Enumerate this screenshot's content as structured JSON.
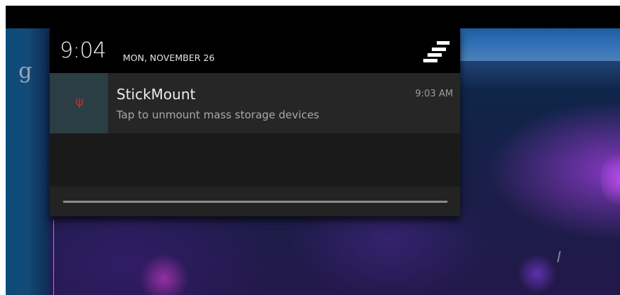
{
  "status_bar": {
    "time": "9:04",
    "date": "MON, NOVEMBER 26",
    "settings_icon": "quick-settings-icon"
  },
  "search": {
    "glyph": "g",
    "icon": "google-search-icon"
  },
  "notifications": [
    {
      "app": "StickMount",
      "text": "Tap to unmount mass storage devices",
      "time": "9:03 AM",
      "icon_glyph": "ψ",
      "icon": "usb-icon",
      "icon_color": "#b8322e"
    }
  ],
  "colors": {
    "shade_bg": "#1c1c1c",
    "header_bg": "#000000",
    "notification_bg": "#262626",
    "icon_box_bg": "#2a3e44"
  }
}
